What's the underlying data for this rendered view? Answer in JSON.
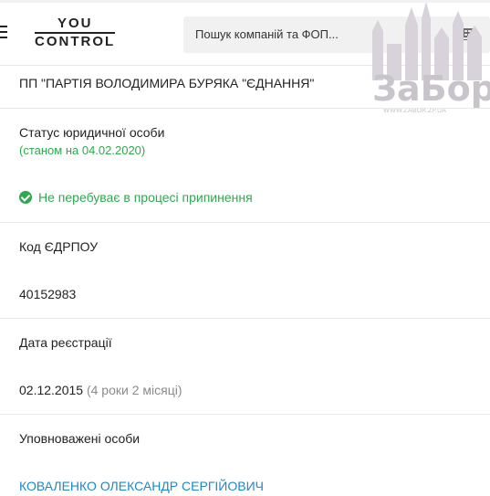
{
  "header": {
    "logo_top": "YOU",
    "logo_bottom": "CONTROL",
    "search_placeholder": "Пошук компаній та ФОП...",
    "keyboard_icon": "keyboard-icon"
  },
  "watermark": {
    "title": "ЗаБор",
    "url": "WWW.ZABOR.ZP.UA"
  },
  "company": {
    "name": "ПП \"ПАРТІЯ ВОЛОДИМИРА БУРЯКА \"ЄДНАННЯ\""
  },
  "status": {
    "label": "Статус юридичної особи",
    "as_of": "(станом на 04.02.2020)",
    "value": "Не перебуває в процесі припинення",
    "icon": "check-circle-icon"
  },
  "edrpou": {
    "label": "Код ЄДРПОУ",
    "value": "40152983"
  },
  "registration": {
    "label": "Дата реєстрації",
    "date": "02.12.2015",
    "age": "(4 роки 2 місяці)"
  },
  "authorized": {
    "label": "Уповноважені особи",
    "person": "КОВАЛЕНКО ОЛЕКСАНДР СЕРГІЙОВИЧ"
  },
  "colors": {
    "green": "#2fa84f",
    "link": "#1e88c8",
    "watermark": "#c9c4cc"
  }
}
